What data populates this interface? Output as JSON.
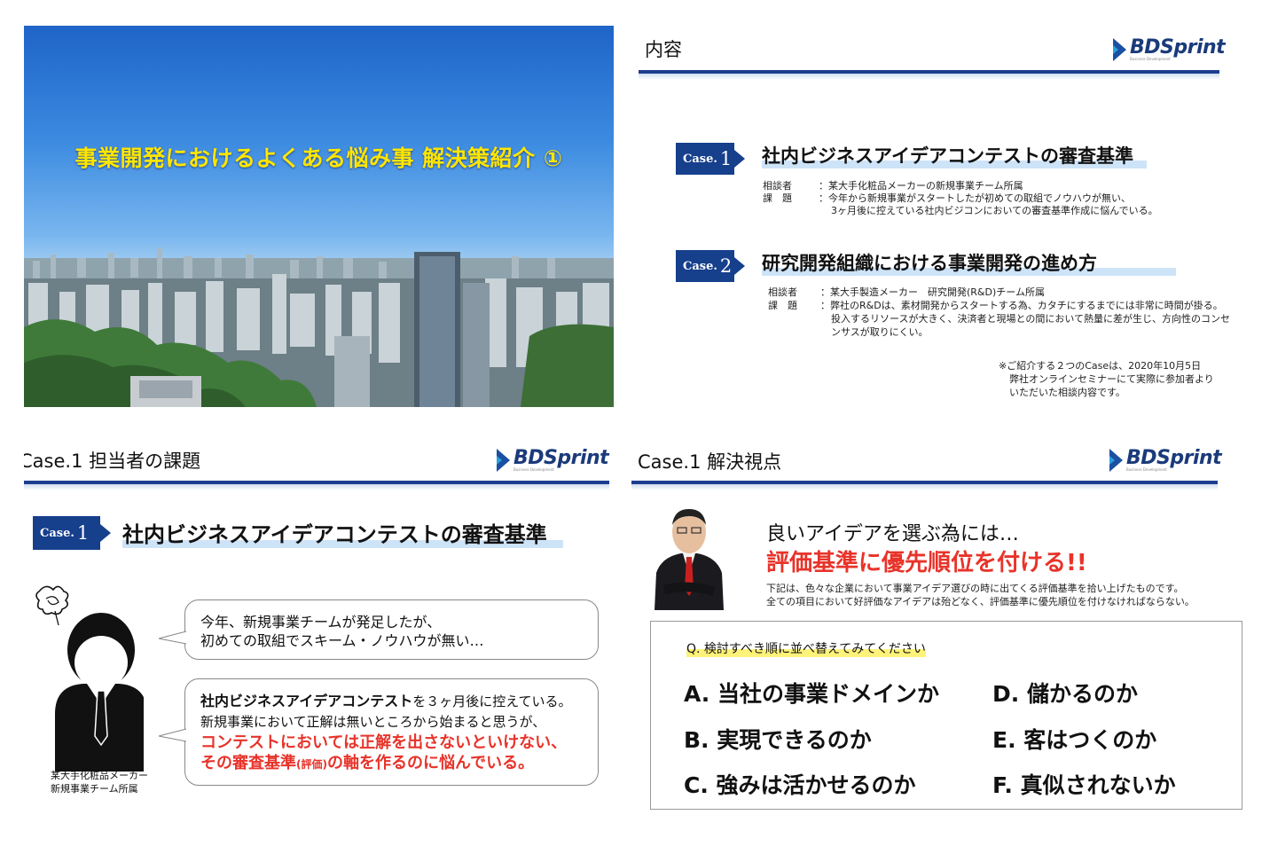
{
  "slide1": {
    "title": "事業開発におけるよくある悩み事 解決策紹介 ①"
  },
  "slide2": {
    "heading": "内容",
    "logo": "BDSprint",
    "logo_sub": "Business Development",
    "case1": {
      "badge_label": "Case.",
      "badge_num": "1",
      "title": "社内ビジネスアイデアコンテストの審査基準",
      "label1": "相談者",
      "value1": "：某大手化粧品メーカーの新規事業チーム所属",
      "label2": "課　題",
      "value2a": "：今年から新規事業がスタートしたが初めての取組でノウハウが無い、",
      "value2b": "3ヶ月後に控えている社内ビジコンにおいての審査基準作成に悩んでいる。"
    },
    "case2": {
      "badge_label": "Case.",
      "badge_num": "2",
      "title": "研究開発組織における事業開発の進め方",
      "label1": "相談者",
      "value1": "：某大手製造メーカー　研究開発(R&D)チーム所属",
      "label2": "課　題",
      "value2a": "：弊社のR&Dは、素材開発からスタートする為、カタチにするまでには非常に時間が掛る。",
      "value2b": "投入するリソースが大きく、決済者と現場との間において熱量に差が生じ、方向性のコンセ",
      "value2c": "ンサスが取りにくい。"
    },
    "note1": "※ご紹介する２つのCaseは、2020年10月5日",
    "note2": "弊社オンラインセミナーにて実際に参加者より",
    "note3": "いただいた相談内容です。"
  },
  "slide3": {
    "heading": "Case.1 担当者の課題",
    "logo": "BDSprint",
    "logo_sub": "Business Development",
    "badge_label": "Case.",
    "badge_num": "1",
    "title": "社内ビジネスアイデアコンテストの審査基準",
    "bubble1_line1": "今年、新規事業チームが発足したが、",
    "bubble1_line2": "初めての取組でスキーム・ノウハウが無い…",
    "bubble2_bold": "社内ビジネスアイデアコンテスト",
    "bubble2_rest": "を３ヶ月後に控えている。",
    "bubble2_line2": "新規事業において正解は無いところから始まると思うが、",
    "bubble2_red1": "コンテストにおいては正解を出さないといけない、",
    "bubble2_red2a": "その審査基準",
    "bubble2_red2_small": "(評価)",
    "bubble2_red2b": "の軸を作るのに悩んでいる。",
    "caption1": "某大手化粧品メーカー",
    "caption2": "新規事業チーム所属"
  },
  "slide4": {
    "heading": "Case.1 解決視点",
    "logo": "BDSprint",
    "logo_sub": "Business Development",
    "lead": "良いアイデアを選ぶ為には…",
    "headline": "評価基準に優先順位を付ける!!",
    "desc1": "下記は、色々な企業において事業アイデア選びの時に出てくる評価基準を拾い上げたものです。",
    "desc2": "全ての項目において好評価なアイデアは殆どなく、評価基準に優先順位を付けなければならない。",
    "question": "Q. 検討すべき順に並べ替えてみてください",
    "options": [
      "A. 当社の事業ドメインか",
      "B. 実現できるのか",
      "C. 強みは活かせるのか",
      "D. 儲かるのか",
      "E. 客はつくのか",
      "F. 真似されないか"
    ]
  }
}
